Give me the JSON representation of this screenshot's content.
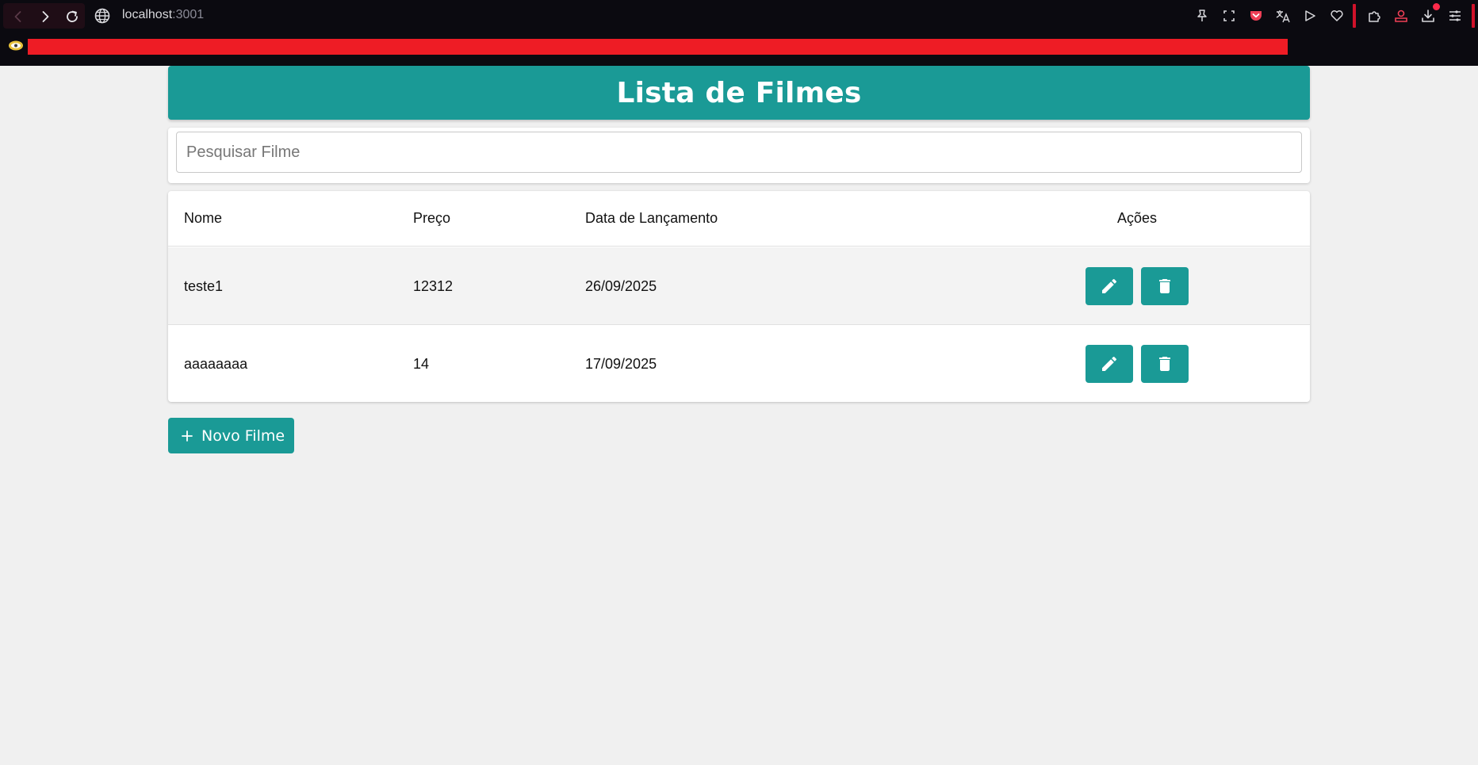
{
  "browser": {
    "url_host": "localhost",
    "url_port": ":3001",
    "icons": [
      "pin-icon",
      "screenshot-icon",
      "pocket-icon",
      "translate-icon",
      "send-icon",
      "heart-icon",
      "extensions-icon",
      "account-icon",
      "download-icon",
      "menu-icon"
    ],
    "accent_color": "#ee1c25"
  },
  "page": {
    "title": "Lista de Filmes",
    "search_placeholder": "Pesquisar Filme",
    "search_value": ""
  },
  "table": {
    "headers": {
      "name": "Nome",
      "price": "Preço",
      "release": "Data de Lançamento",
      "actions": "Ações"
    },
    "rows": [
      {
        "name": "teste1",
        "price": "12312",
        "release": "26/09/2025"
      },
      {
        "name": "aaaaaaaa",
        "price": "14",
        "release": "17/09/2025"
      }
    ]
  },
  "actions": {
    "new_button_label": "Novo Filme"
  },
  "colors": {
    "primary": "#1a9a96",
    "background": "#f0f0f0"
  }
}
